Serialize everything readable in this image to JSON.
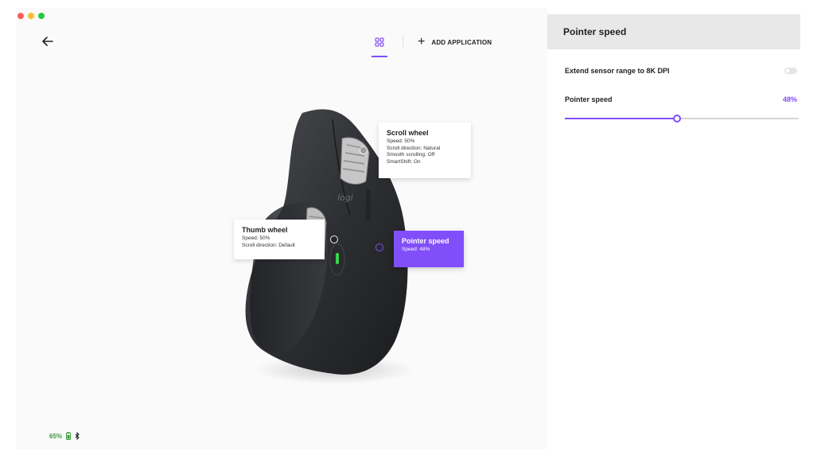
{
  "window": {
    "traffic_colors": [
      "#fc5f57",
      "#fdbc2e",
      "#28c840"
    ]
  },
  "toolbar": {
    "add_application_label": "ADD APPLICATION",
    "accent_color": "#814efa"
  },
  "callouts": {
    "scroll_wheel": {
      "title": "Scroll wheel",
      "lines": [
        "Speed: 50%",
        "Scroll direction: Natural",
        "Smooth scrolling: Off",
        "SmartShift: On"
      ]
    },
    "thumb_wheel": {
      "title": "Thumb wheel",
      "lines": [
        "Speed: 50%",
        "Scroll direction: Default"
      ]
    },
    "pointer_speed": {
      "title": "Pointer speed",
      "lines": [
        "Speed: 48%"
      ]
    }
  },
  "status": {
    "battery_level": "65%",
    "battery_color": "#3a9a3a"
  },
  "panel": {
    "title": "Pointer speed",
    "extend_sensor_label": "Extend sensor range to 8K DPI",
    "extend_sensor_enabled": false,
    "pointer_speed_label": "Pointer speed",
    "pointer_speed_value": "48%",
    "pointer_speed_fraction": 0.48
  }
}
